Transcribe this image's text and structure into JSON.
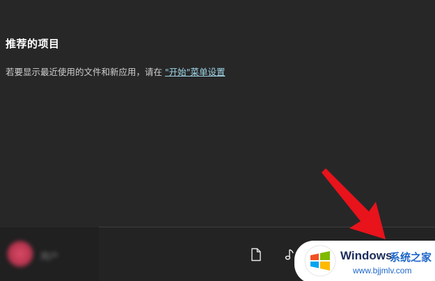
{
  "recommended": {
    "title": "推荐的项目",
    "message_prefix": "若要显示最近使用的文件和新应用，请在 ",
    "link_text": "\"开始\"菜单设置"
  },
  "user": {
    "name": "用户"
  },
  "taskbar": {
    "icons": [
      "document-icon",
      "music-icon"
    ]
  },
  "watermark": {
    "brand": "Windows",
    "brand_cn": "系统之家",
    "url": "www.bjjmlv.com"
  },
  "colors": {
    "background": "#272728",
    "link": "#9ed6e6",
    "arrow": "#e8131b"
  }
}
